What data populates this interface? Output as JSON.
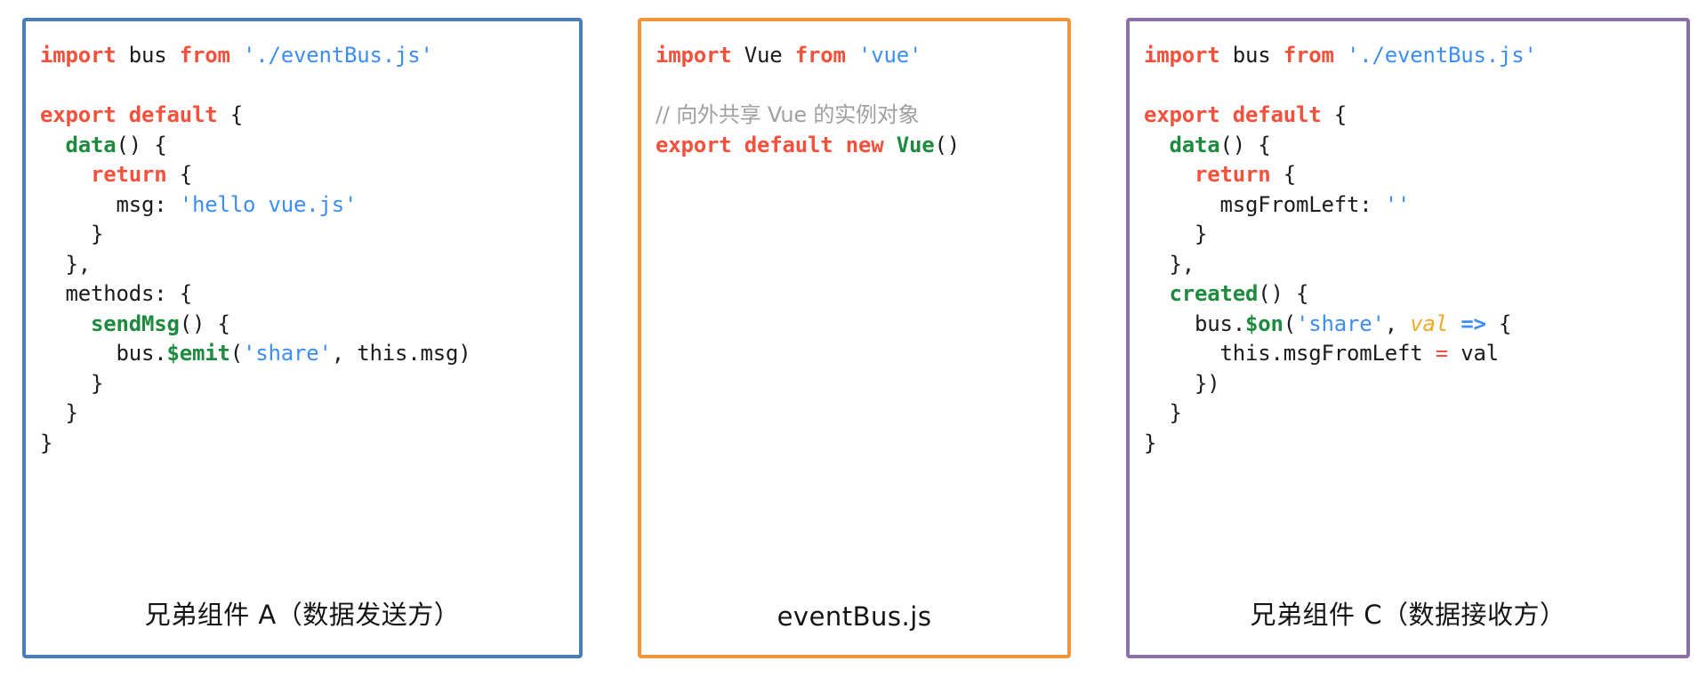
{
  "diagram": {
    "title": "Vue EventBus sibling component communication",
    "colors": {
      "panel_left_border": "#4a7ebb",
      "panel_mid_border": "#f0963c",
      "panel_right_border": "#8a6fa8",
      "keyword": "#f4513c",
      "string": "#3d8ef2",
      "function": "#1d8a3d",
      "comment": "#a0a0a0",
      "param": "#f5a623",
      "plain": "#1b1b1b"
    },
    "panels": [
      {
        "id": "sibling-a",
        "caption": "兄弟组件 A（数据发送方）",
        "code_lines": [
          {
            "tokens": [
              {
                "t": "import",
                "c": "kw"
              },
              {
                "t": " bus ",
                "c": "pl"
              },
              {
                "t": "from",
                "c": "kw"
              },
              {
                "t": " ",
                "c": "pl"
              },
              {
                "t": "'./eventBus.js'",
                "c": "str"
              }
            ]
          },
          {
            "tokens": []
          },
          {
            "tokens": [
              {
                "t": "export default",
                "c": "kw"
              },
              {
                "t": " {",
                "c": "pl"
              }
            ]
          },
          {
            "tokens": [
              {
                "t": "  ",
                "c": "pl"
              },
              {
                "t": "data",
                "c": "fn"
              },
              {
                "t": "() {",
                "c": "pl"
              }
            ]
          },
          {
            "tokens": [
              {
                "t": "    ",
                "c": "pl"
              },
              {
                "t": "return",
                "c": "kw"
              },
              {
                "t": " {",
                "c": "pl"
              }
            ]
          },
          {
            "tokens": [
              {
                "t": "      msg: ",
                "c": "pl"
              },
              {
                "t": "'hello vue.js'",
                "c": "str"
              }
            ]
          },
          {
            "tokens": [
              {
                "t": "    }",
                "c": "pl"
              }
            ]
          },
          {
            "tokens": [
              {
                "t": "  },",
                "c": "pl"
              }
            ]
          },
          {
            "tokens": [
              {
                "t": "  methods: {",
                "c": "pl"
              }
            ]
          },
          {
            "tokens": [
              {
                "t": "    ",
                "c": "pl"
              },
              {
                "t": "sendMsg",
                "c": "fn"
              },
              {
                "t": "() {",
                "c": "pl"
              }
            ]
          },
          {
            "tokens": [
              {
                "t": "      bus.",
                "c": "pl"
              },
              {
                "t": "$emit",
                "c": "fn"
              },
              {
                "t": "(",
                "c": "pl"
              },
              {
                "t": "'share'",
                "c": "str"
              },
              {
                "t": ", this.msg)",
                "c": "pl"
              }
            ]
          },
          {
            "tokens": [
              {
                "t": "    }",
                "c": "pl"
              }
            ]
          },
          {
            "tokens": [
              {
                "t": "  }",
                "c": "pl"
              }
            ]
          },
          {
            "tokens": [
              {
                "t": "}",
                "c": "pl"
              }
            ]
          }
        ]
      },
      {
        "id": "event-bus",
        "caption": "eventBus.js",
        "code_lines": [
          {
            "tokens": [
              {
                "t": "import",
                "c": "kw"
              },
              {
                "t": " Vue ",
                "c": "pl"
              },
              {
                "t": "from",
                "c": "kw"
              },
              {
                "t": " ",
                "c": "pl"
              },
              {
                "t": "'vue'",
                "c": "str"
              }
            ]
          },
          {
            "tokens": []
          },
          {
            "tokens": [
              {
                "t": "// 向外共享 Vue 的实例对象",
                "c": "cmt"
              }
            ]
          },
          {
            "tokens": [
              {
                "t": "export default new",
                "c": "kw"
              },
              {
                "t": " ",
                "c": "pl"
              },
              {
                "t": "Vue",
                "c": "fn"
              },
              {
                "t": "()",
                "c": "pl"
              }
            ]
          }
        ]
      },
      {
        "id": "sibling-c",
        "caption": "兄弟组件 C（数据接收方）",
        "code_lines": [
          {
            "tokens": [
              {
                "t": "import",
                "c": "kw"
              },
              {
                "t": " bus ",
                "c": "pl"
              },
              {
                "t": "from",
                "c": "kw"
              },
              {
                "t": " ",
                "c": "pl"
              },
              {
                "t": "'./eventBus.js'",
                "c": "str"
              }
            ]
          },
          {
            "tokens": []
          },
          {
            "tokens": [
              {
                "t": "export default",
                "c": "kw"
              },
              {
                "t": " {",
                "c": "pl"
              }
            ]
          },
          {
            "tokens": [
              {
                "t": "  ",
                "c": "pl"
              },
              {
                "t": "data",
                "c": "fn"
              },
              {
                "t": "() {",
                "c": "pl"
              }
            ]
          },
          {
            "tokens": [
              {
                "t": "    ",
                "c": "pl"
              },
              {
                "t": "return",
                "c": "kw"
              },
              {
                "t": " {",
                "c": "pl"
              }
            ]
          },
          {
            "tokens": [
              {
                "t": "      msgFromLeft: ",
                "c": "pl"
              },
              {
                "t": "''",
                "c": "str"
              }
            ]
          },
          {
            "tokens": [
              {
                "t": "    }",
                "c": "pl"
              }
            ]
          },
          {
            "tokens": [
              {
                "t": "  },",
                "c": "pl"
              }
            ]
          },
          {
            "tokens": [
              {
                "t": "  ",
                "c": "pl"
              },
              {
                "t": "created",
                "c": "fn"
              },
              {
                "t": "() {",
                "c": "pl"
              }
            ]
          },
          {
            "tokens": [
              {
                "t": "    bus.",
                "c": "pl"
              },
              {
                "t": "$on",
                "c": "fn"
              },
              {
                "t": "(",
                "c": "pl"
              },
              {
                "t": "'share'",
                "c": "str"
              },
              {
                "t": ", ",
                "c": "pl"
              },
              {
                "t": "val",
                "c": "arg"
              },
              {
                "t": " ",
                "c": "pl"
              },
              {
                "t": "=>",
                "c": "arrow"
              },
              {
                "t": " {",
                "c": "pl"
              }
            ]
          },
          {
            "tokens": [
              {
                "t": "      this.msgFromLeft ",
                "c": "pl"
              },
              {
                "t": "=",
                "c": "op"
              },
              {
                "t": " val",
                "c": "pl"
              }
            ]
          },
          {
            "tokens": [
              {
                "t": "    })",
                "c": "pl"
              }
            ]
          },
          {
            "tokens": [
              {
                "t": "  }",
                "c": "pl"
              }
            ]
          },
          {
            "tokens": [
              {
                "t": "}",
                "c": "pl"
              }
            ]
          }
        ]
      }
    ]
  }
}
